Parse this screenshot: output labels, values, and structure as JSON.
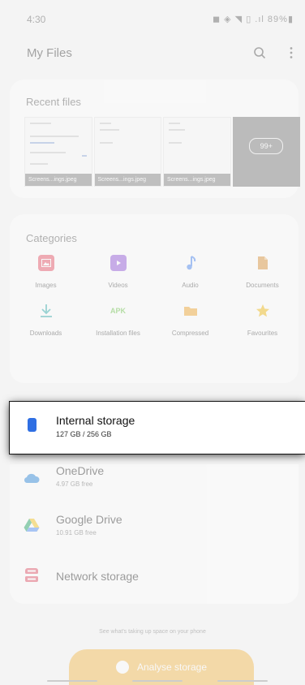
{
  "status_bar": {
    "time": "4:30",
    "icons_text": "◼ ◈ ◥ ▯ .ıl 89%▮",
    "battery": "89%"
  },
  "header": {
    "title": "My Files",
    "search_icon": "search-icon",
    "more_icon": "more-vert-icon"
  },
  "recent": {
    "title": "Recent files",
    "files": [
      {
        "label": "Screens...ings.jpeg"
      },
      {
        "label": "Screens...ings.jpeg"
      },
      {
        "label": "Screens...ings.jpeg"
      }
    ],
    "more_badge": "99+"
  },
  "categories": {
    "title": "Categories",
    "items": [
      {
        "label": "Images",
        "icon": "image-icon",
        "color": "#e6455a"
      },
      {
        "label": "Videos",
        "icon": "video-icon",
        "color": "#8a4bd6"
      },
      {
        "label": "Audio",
        "icon": "music-note-icon",
        "color": "#3a7cf0"
      },
      {
        "label": "Documents",
        "icon": "document-icon",
        "color": "#d98a2a"
      },
      {
        "label": "Downloads",
        "icon": "download-icon",
        "color": "#1fa6a6"
      },
      {
        "label": "Installation files",
        "icon": "apk-icon",
        "color": "#5fbf3a",
        "glyph": "APK"
      },
      {
        "label": "Compressed",
        "icon": "folder-icon",
        "color": "#f0a020"
      },
      {
        "label": "Favourites",
        "icon": "star-icon",
        "color": "#f0b400"
      }
    ]
  },
  "storage": {
    "internal": {
      "name": "Internal storage",
      "detail": "127 GB / 256 GB",
      "icon": "phone-storage-icon",
      "color": "#2f6fe3"
    },
    "onedrive": {
      "name": "OneDrive",
      "detail": "4.97 GB free",
      "icon": "cloud-icon",
      "color": "#1c7fd8"
    },
    "gdrive": {
      "name": "Google Drive",
      "detail": "10.91 GB free",
      "icon": "google-drive-icon"
    },
    "network": {
      "name": "Network storage",
      "icon": "network-storage-icon",
      "color": "#e0435a"
    }
  },
  "footer": {
    "hint": "See what's taking up space on your phone",
    "analyse_label": "Analyse storage",
    "accent": "#f2b441"
  }
}
